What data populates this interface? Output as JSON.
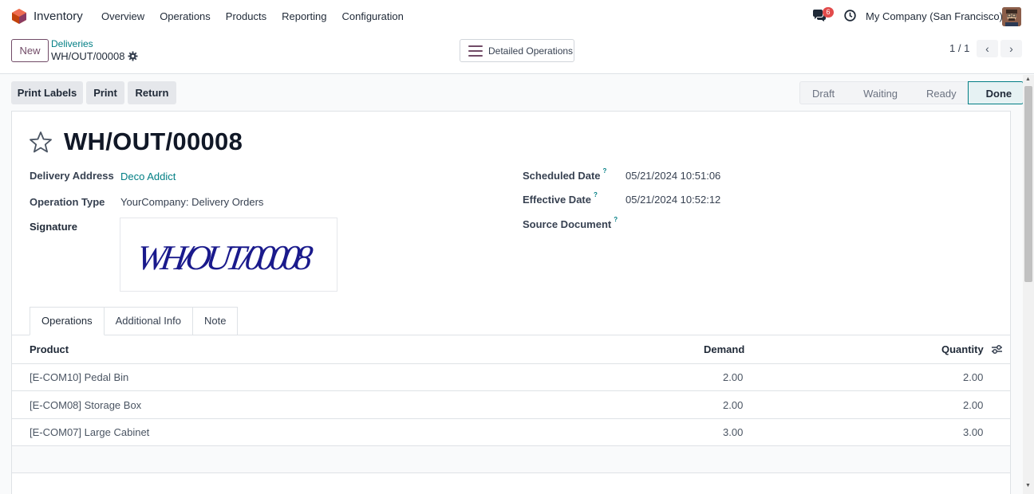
{
  "navbar": {
    "app_name": "Inventory",
    "menu": [
      "Overview",
      "Operations",
      "Products",
      "Reporting",
      "Configuration"
    ],
    "messages_count": "6",
    "company": "My Company (San Francisco)"
  },
  "control": {
    "new_label": "New",
    "breadcrumb_parent": "Deliveries",
    "breadcrumb_current": "WH/OUT/00008",
    "detailed_operations_label": "Detailed Operations",
    "pager": "1 / 1"
  },
  "actions": {
    "print_labels": "Print Labels",
    "print": "Print",
    "return": "Return"
  },
  "statusbar": [
    "Draft",
    "Waiting",
    "Ready",
    "Done"
  ],
  "record": {
    "title": "WH/OUT/00008",
    "delivery_address_label": "Delivery Address",
    "delivery_address": "Deco Addict",
    "operation_type_label": "Operation Type",
    "operation_type": "YourCompany: Delivery Orders",
    "signature_label": "Signature",
    "signature_text": "WH/OUT/00008",
    "scheduled_date_label": "Scheduled Date",
    "scheduled_date": "05/21/2024 10:51:06",
    "effective_date_label": "Effective Date",
    "effective_date": "05/21/2024 10:52:12",
    "source_document_label": "Source Document",
    "help_mark": "?"
  },
  "tabs": [
    "Operations",
    "Additional Info",
    "Note"
  ],
  "table": {
    "headers": [
      "Product",
      "Demand",
      "Quantity"
    ],
    "rows": [
      {
        "product": "[E-COM10] Pedal Bin",
        "demand": "2.00",
        "quantity": "2.00"
      },
      {
        "product": "[E-COM08] Storage Box",
        "demand": "2.00",
        "quantity": "2.00"
      },
      {
        "product": "[E-COM07] Large Cabinet",
        "demand": "3.00",
        "quantity": "3.00"
      }
    ]
  },
  "colors": {
    "brand": "#714b67",
    "link": "#017e84",
    "badge": "#e24b4b"
  }
}
